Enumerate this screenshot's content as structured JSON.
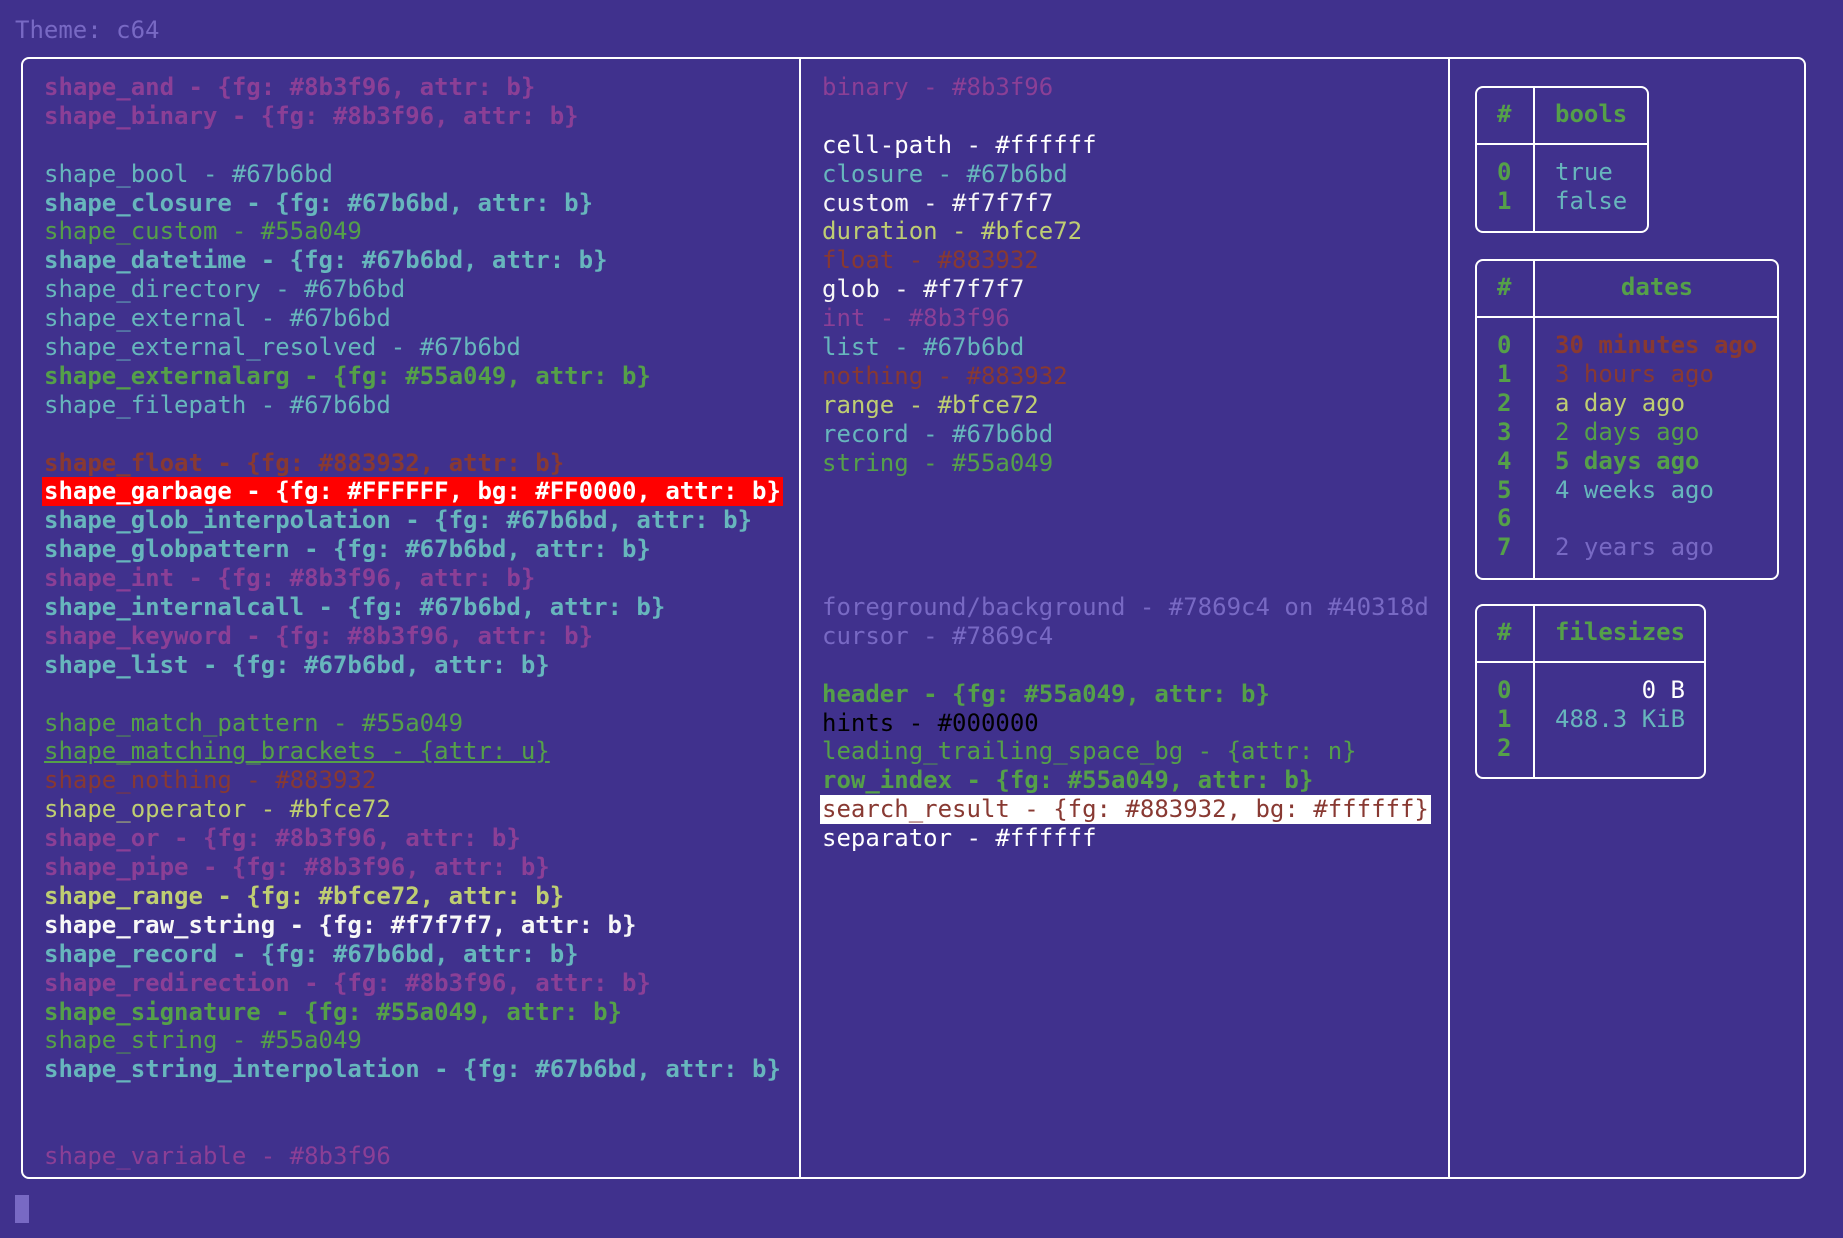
{
  "theme_title": "Theme: c64",
  "colors": {
    "background": "#40318d",
    "foreground": "#7869c4",
    "border": "#ffffff"
  },
  "left_column": [
    {
      "text": "shape_and - {fg: #8b3f96, attr: b}",
      "color": "#8b3f96",
      "bold": true
    },
    {
      "text": "shape_binary - {fg: #8b3f96, attr: b}",
      "color": "#8b3f96",
      "bold": true
    },
    {
      "text": "",
      "color": "#7869c4"
    },
    {
      "text": "shape_bool - #67b6bd",
      "color": "#67b6bd"
    },
    {
      "text": "shape_closure - {fg: #67b6bd, attr: b}",
      "color": "#67b6bd",
      "bold": true
    },
    {
      "text": "shape_custom - #55a049",
      "color": "#55a049"
    },
    {
      "text": "shape_datetime - {fg: #67b6bd, attr: b}",
      "color": "#67b6bd",
      "bold": true
    },
    {
      "text": "shape_directory - #67b6bd",
      "color": "#67b6bd"
    },
    {
      "text": "shape_external - #67b6bd",
      "color": "#67b6bd"
    },
    {
      "text": "shape_external_resolved - #67b6bd",
      "color": "#67b6bd"
    },
    {
      "text": "shape_externalarg - {fg: #55a049, attr: b}",
      "color": "#55a049",
      "bold": true
    },
    {
      "text": "shape_filepath - #67b6bd",
      "color": "#67b6bd"
    },
    {
      "text": "",
      "color": "#7869c4"
    },
    {
      "text": "shape_float - {fg: #883932, attr: b}",
      "color": "#883932",
      "bold": true
    },
    {
      "text": "shape_garbage - {fg: #FFFFFF, bg: #FF0000, attr: b}",
      "color": "#FFFFFF",
      "bg": "#FF0000",
      "bold": true
    },
    {
      "text": "shape_glob_interpolation - {fg: #67b6bd, attr: b}",
      "color": "#67b6bd",
      "bold": true
    },
    {
      "text": "shape_globpattern - {fg: #67b6bd, attr: b}",
      "color": "#67b6bd",
      "bold": true
    },
    {
      "text": "shape_int - {fg: #8b3f96, attr: b}",
      "color": "#8b3f96",
      "bold": true
    },
    {
      "text": "shape_internalcall - {fg: #67b6bd, attr: b}",
      "color": "#67b6bd",
      "bold": true
    },
    {
      "text": "shape_keyword - {fg: #8b3f96, attr: b}",
      "color": "#8b3f96",
      "bold": true
    },
    {
      "text": "shape_list - {fg: #67b6bd, attr: b}",
      "color": "#67b6bd",
      "bold": true
    },
    {
      "text": "",
      "color": "#7869c4"
    },
    {
      "text": "shape_match_pattern - #55a049",
      "color": "#55a049"
    },
    {
      "text": "shape_matching_brackets - {attr: u}",
      "color": "#55a049",
      "underline": true
    },
    {
      "text": "shape_nothing - #883932",
      "color": "#883932"
    },
    {
      "text": "shape_operator - #bfce72",
      "color": "#bfce72"
    },
    {
      "text": "shape_or - {fg: #8b3f96, attr: b}",
      "color": "#8b3f96",
      "bold": true
    },
    {
      "text": "shape_pipe - {fg: #8b3f96, attr: b}",
      "color": "#8b3f96",
      "bold": true
    },
    {
      "text": "shape_range - {fg: #bfce72, attr: b}",
      "color": "#bfce72",
      "bold": true
    },
    {
      "text": "shape_raw_string - {fg: #f7f7f7, attr: b}",
      "color": "#f7f7f7",
      "bold": true
    },
    {
      "text": "shape_record - {fg: #67b6bd, attr: b}",
      "color": "#67b6bd",
      "bold": true
    },
    {
      "text": "shape_redirection - {fg: #8b3f96, attr: b}",
      "color": "#8b3f96",
      "bold": true
    },
    {
      "text": "shape_signature - {fg: #55a049, attr: b}",
      "color": "#55a049",
      "bold": true
    },
    {
      "text": "shape_string - #55a049",
      "color": "#55a049"
    },
    {
      "text": "shape_string_interpolation - {fg: #67b6bd, attr: b}",
      "color": "#67b6bd",
      "bold": true
    },
    {
      "text": "",
      "color": "#7869c4"
    },
    {
      "text": "",
      "color": "#7869c4"
    },
    {
      "text": "shape_variable - #8b3f96",
      "color": "#8b3f96"
    }
  ],
  "middle_column": [
    {
      "text": "binary - #8b3f96",
      "color": "#8b3f96"
    },
    {
      "text": "",
      "color": "#7869c4"
    },
    {
      "text": "cell-path - #ffffff",
      "color": "#ffffff"
    },
    {
      "text": "closure - #67b6bd",
      "color": "#67b6bd"
    },
    {
      "text": "custom - #f7f7f7",
      "color": "#f7f7f7"
    },
    {
      "text": "duration - #bfce72",
      "color": "#bfce72"
    },
    {
      "text": "float - #883932",
      "color": "#883932"
    },
    {
      "text": "glob - #f7f7f7",
      "color": "#f7f7f7"
    },
    {
      "text": "int - #8b3f96",
      "color": "#8b3f96"
    },
    {
      "text": "list - #67b6bd",
      "color": "#67b6bd"
    },
    {
      "text": "nothing - #883932",
      "color": "#883932"
    },
    {
      "text": "range - #bfce72",
      "color": "#bfce72"
    },
    {
      "text": "record - #67b6bd",
      "color": "#67b6bd"
    },
    {
      "text": "string - #55a049",
      "color": "#55a049"
    },
    {
      "text": "",
      "color": "#7869c4"
    },
    {
      "text": "",
      "color": "#7869c4"
    },
    {
      "text": "",
      "color": "#7869c4"
    },
    {
      "text": "",
      "color": "#7869c4"
    },
    {
      "text": "foreground/background - #7869c4 on #40318d",
      "color": "#7869c4"
    },
    {
      "text": "cursor - #7869c4",
      "color": "#7869c4"
    },
    {
      "text": "",
      "color": "#7869c4"
    },
    {
      "text": "header - {fg: #55a049, attr: b}",
      "color": "#55a049",
      "bold": true
    },
    {
      "text": "hints - #000000",
      "color": "#000000"
    },
    {
      "text": "leading_trailing_space_bg - {attr: n}",
      "color": "#55a049"
    },
    {
      "text": "row_index - {fg: #55a049, attr: b}",
      "color": "#55a049",
      "bold": true
    },
    {
      "text": "search_result - {fg: #883932, bg: #ffffff}",
      "color": "#883932",
      "bg": "#ffffff"
    },
    {
      "text": "separator - #ffffff",
      "color": "#ffffff"
    }
  ],
  "tables": {
    "bools": {
      "index_header": "#",
      "header": "bools",
      "rows": [
        {
          "index": "0",
          "value": "true",
          "color": "#67b6bd"
        },
        {
          "index": "1",
          "value": "false",
          "color": "#67b6bd"
        }
      ]
    },
    "dates": {
      "index_header": "#",
      "header": "dates",
      "rows": [
        {
          "index": "0",
          "value": "30 minutes ago",
          "color": "#883932",
          "bold": true
        },
        {
          "index": "1",
          "value": "3 hours ago",
          "color": "#883932"
        },
        {
          "index": "2",
          "value": "a day ago",
          "color": "#bfce72"
        },
        {
          "index": "3",
          "value": "2 days ago",
          "color": "#55a049"
        },
        {
          "index": "4",
          "value": "5 days ago",
          "color": "#55a049",
          "bold": true
        },
        {
          "index": "5",
          "value": "4 weeks ago",
          "color": "#67b6bd"
        },
        {
          "index": "6",
          "value": "",
          "color": "#67b6bd"
        },
        {
          "index": "7",
          "value": "2 years ago",
          "color": "#7869c4"
        }
      ]
    },
    "filesizes": {
      "index_header": "#",
      "header": "filesizes",
      "rows": [
        {
          "index": "0",
          "value": "0 B",
          "color": "#ffffff",
          "align": "right"
        },
        {
          "index": "1",
          "value": "488.3 KiB",
          "color": "#67b6bd"
        },
        {
          "index": "2",
          "value": "",
          "color": "#67b6bd"
        }
      ]
    }
  }
}
